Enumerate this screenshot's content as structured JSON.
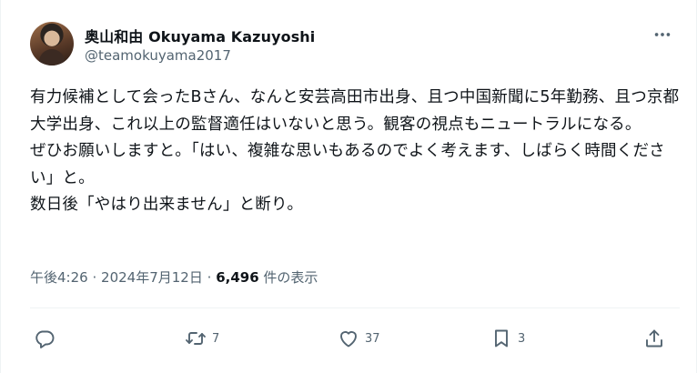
{
  "author": {
    "display_name": "奥山和由 Okuyama Kazuyoshi",
    "handle": "@teamokuyama2017"
  },
  "tweet": {
    "text": "有力候補として会ったBさん、なんと安芸高田市出身、且つ中国新聞に5年勤務、且つ京都大学出身、これ以上の監督適任はいないと思う。観客の視点もニュートラルになる。\nぜひお願いしますと。「はい、複雑な思いもあるのでよく考えます、しばらく時間ください」と。\n数日後「やはり出来ません」と断り。",
    "time": "午後4:26",
    "separator": "·",
    "date": "2024年7月12日",
    "views_count": "6,496",
    "views_label": "件の表示"
  },
  "actions": {
    "reply_count": "",
    "retweet_count": "7",
    "like_count": "37",
    "bookmark_count": "3"
  },
  "colors": {
    "text": "#0f1419",
    "secondary": "#536471",
    "divider": "#eff3f4"
  },
  "icons": [
    "more-icon",
    "reply-icon",
    "retweet-icon",
    "like-icon",
    "bookmark-icon",
    "share-icon"
  ]
}
